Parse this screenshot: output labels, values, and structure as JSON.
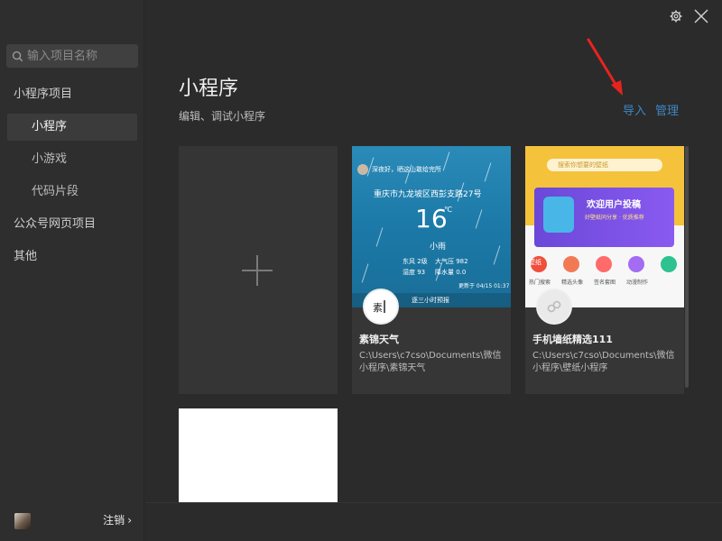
{
  "search": {
    "placeholder": "输入项目名称"
  },
  "sidebar": {
    "items": [
      {
        "label": "小程序项目",
        "type": "group"
      },
      {
        "label": "小程序",
        "type": "sub",
        "active": true
      },
      {
        "label": "小游戏",
        "type": "sub"
      },
      {
        "label": "代码片段",
        "type": "sub"
      },
      {
        "label": "公众号网页项目",
        "type": "group"
      },
      {
        "label": "其他",
        "type": "group"
      }
    ],
    "logout_label": "注销"
  },
  "main": {
    "title": "小程序",
    "subtitle": "编辑、调试小程序",
    "actions": {
      "import_label": "导入",
      "manage_label": "管理"
    }
  },
  "projects": [
    {
      "name": "素锦天气",
      "path": "C:\\Users\\c7cso\\Documents\\微信小程序\\素锦天气",
      "preview": {
        "greeting": "深夜好，晒这山敢给完所",
        "location": "重庆市九龙坡区西彭支路27号",
        "temp": "16",
        "unit": "℃",
        "weather": "小雨",
        "wind": "东风 2级",
        "humidity": "湿度 93",
        "pressure": "大气压 982",
        "rain": "降水量 0.0",
        "updated": "更新于 04/15 01:37",
        "forecast_label": "逐三小时预报"
      }
    },
    {
      "name": "手机墙纸精选111",
      "path": "C:\\Users\\c7cso\\Documents\\微信小程序\\壁纸小程序",
      "preview": {
        "search_placeholder": "搜索你想要的壁纸",
        "banner_title": "欢迎用户投稿",
        "banner_sub": "好壁纸同分享 · 优质推荐",
        "categories": [
          "壁纸",
          "热门搜索",
          "精选头像",
          "签名套图",
          "动漫制作"
        ]
      }
    }
  ],
  "colors": {
    "accent_link": "#3f86c2",
    "arrow": "#e8231f",
    "sidebar_bg": "#2e2e2e",
    "main_bg": "#2b2b2b"
  },
  "icons": [
    "search-icon",
    "settings-icon",
    "close-icon",
    "plus-icon",
    "chevron-right-icon"
  ]
}
